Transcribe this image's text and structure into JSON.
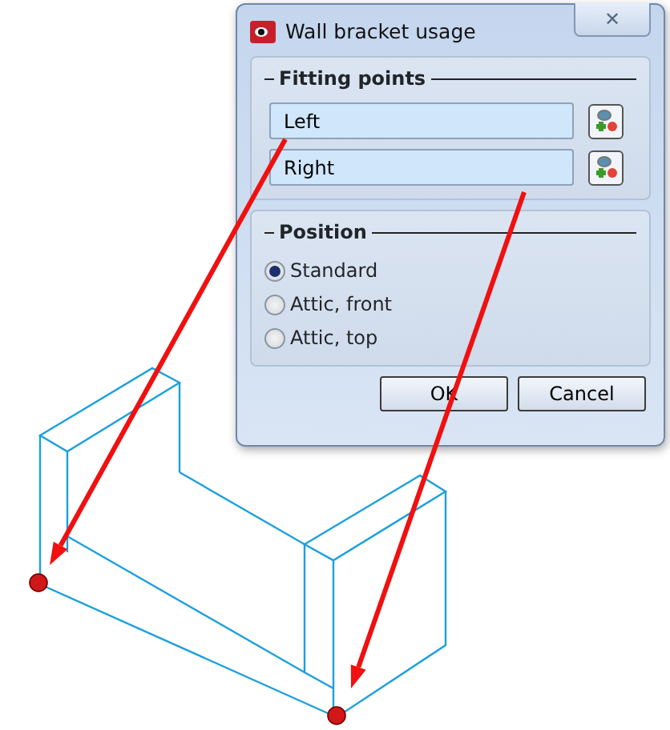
{
  "window": {
    "title": "Wall bracket usage",
    "close": "✕"
  },
  "fitting_points": {
    "title": "Fitting points",
    "fields": [
      {
        "value": "Left"
      },
      {
        "value": "Right"
      }
    ]
  },
  "position": {
    "title": "Position",
    "options": [
      {
        "label": "Standard",
        "selected": true
      },
      {
        "label": "Attic, front",
        "selected": false
      },
      {
        "label": "Attic, top",
        "selected": false
      }
    ]
  },
  "buttons": [
    "OK",
    "Cancel"
  ]
}
